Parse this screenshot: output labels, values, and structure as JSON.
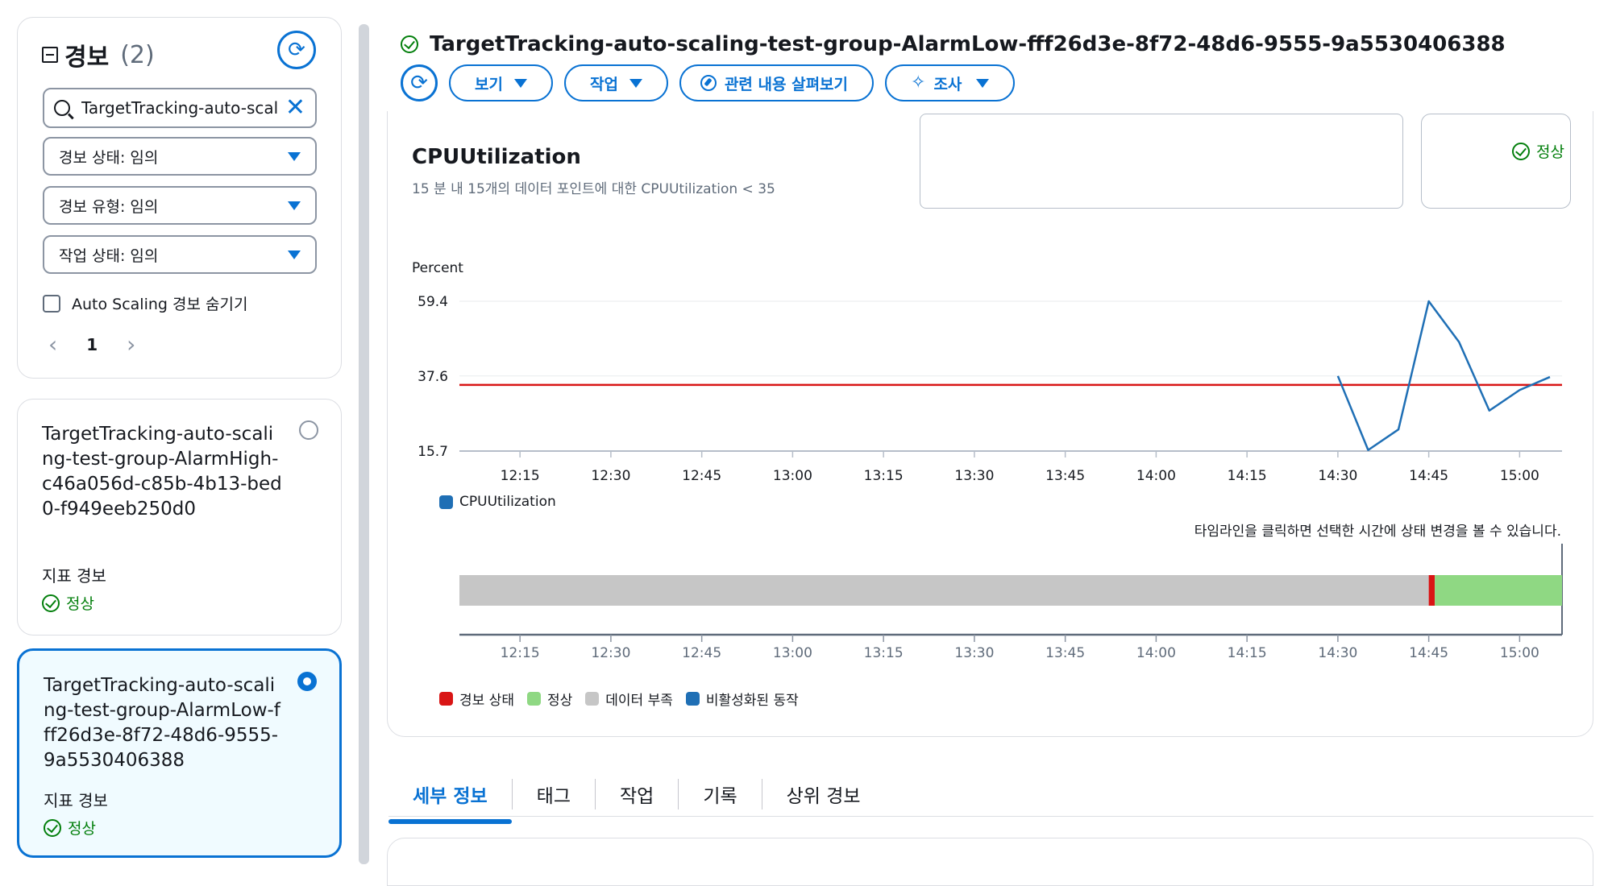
{
  "sidebar": {
    "title": "경보",
    "count": "(2)",
    "search_value": "TargetTracking-auto-scaling-test-group",
    "filters": [
      "경보 상태: 임의",
      "경보 유형: 임의",
      "작업 상태: 임의"
    ],
    "hide_autoscaling_label": "Auto Scaling 경보 숨기기",
    "page": "1",
    "alarms": [
      {
        "name": "TargetTracking-auto-scaling-test-group-AlarmHigh-c46a056d-c85b-4b13-bed0-f949eeb250d0",
        "type": "지표 경보",
        "state": "정상",
        "selected": false
      },
      {
        "name": "TargetTracking-auto-scaling-test-group-AlarmLow-fff26d3e-8f72-48d6-9555-9a5530406388",
        "type": "지표 경보",
        "state": "정상",
        "selected": true
      }
    ]
  },
  "header": {
    "title": "TargetTracking-auto-scaling-test-group-AlarmLow-fff26d3e-8f72-48d6-9555-9a5530406388",
    "buttons": {
      "view": "보기",
      "actions": "작업",
      "explore": "관련 내용 살펴보기",
      "investigate": "조사"
    }
  },
  "chart_panel": {
    "status": "정상",
    "timeline_hint": "타임라인을 클릭하면 선택한 시간에 상태 변경을 볼 수 있습니다.",
    "timeline_legend": [
      {
        "label": "경보 상태",
        "color": "#d91515"
      },
      {
        "label": "정상",
        "color": "#8fd883"
      },
      {
        "label": "데이터 부족",
        "color": "#c6c6c6"
      },
      {
        "label": "비활성화된 동작",
        "color": "#1f6fb5"
      }
    ]
  },
  "tabs": [
    "세부 정보",
    "태그",
    "작업",
    "기록",
    "상위 경보"
  ],
  "colors": {
    "accent": "#0972d3",
    "ok": "#037f0c",
    "threshold": "#d91515",
    "series": "#1f6fb5"
  },
  "chart_data": {
    "type": "line",
    "title": "CPUUtilization",
    "subtitle": "15 분 내 15개의 데이터 포인트에 대한 CPUUtilization < 35",
    "ylabel": "Percent",
    "yticks": [
      15.7,
      37.6,
      59.4
    ],
    "ylim": [
      15.7,
      59.4
    ],
    "xticks": [
      "12:15",
      "12:30",
      "12:45",
      "13:00",
      "13:15",
      "13:30",
      "13:45",
      "14:00",
      "14:15",
      "14:30",
      "14:45",
      "15:00"
    ],
    "xlim": [
      "12:05",
      "15:07"
    ],
    "threshold": 35,
    "series": [
      {
        "name": "CPUUtilization",
        "color": "#1f6fb5",
        "x": [
          "14:30",
          "14:35",
          "14:40",
          "14:45",
          "14:50",
          "14:55",
          "15:00",
          "15:05"
        ],
        "y": [
          37.6,
          16.0,
          22.0,
          59.4,
          47.5,
          27.5,
          33.5,
          37.3
        ]
      }
    ],
    "timeline": {
      "segments": [
        {
          "state": "데이터 부족",
          "from": "12:05",
          "to": "14:45",
          "color": "#c6c6c6"
        },
        {
          "state": "경보 상태",
          "from": "14:45",
          "to": "14:46",
          "color": "#d91515"
        },
        {
          "state": "정상",
          "from": "14:46",
          "to": "15:07",
          "color": "#8fd883"
        }
      ]
    }
  }
}
